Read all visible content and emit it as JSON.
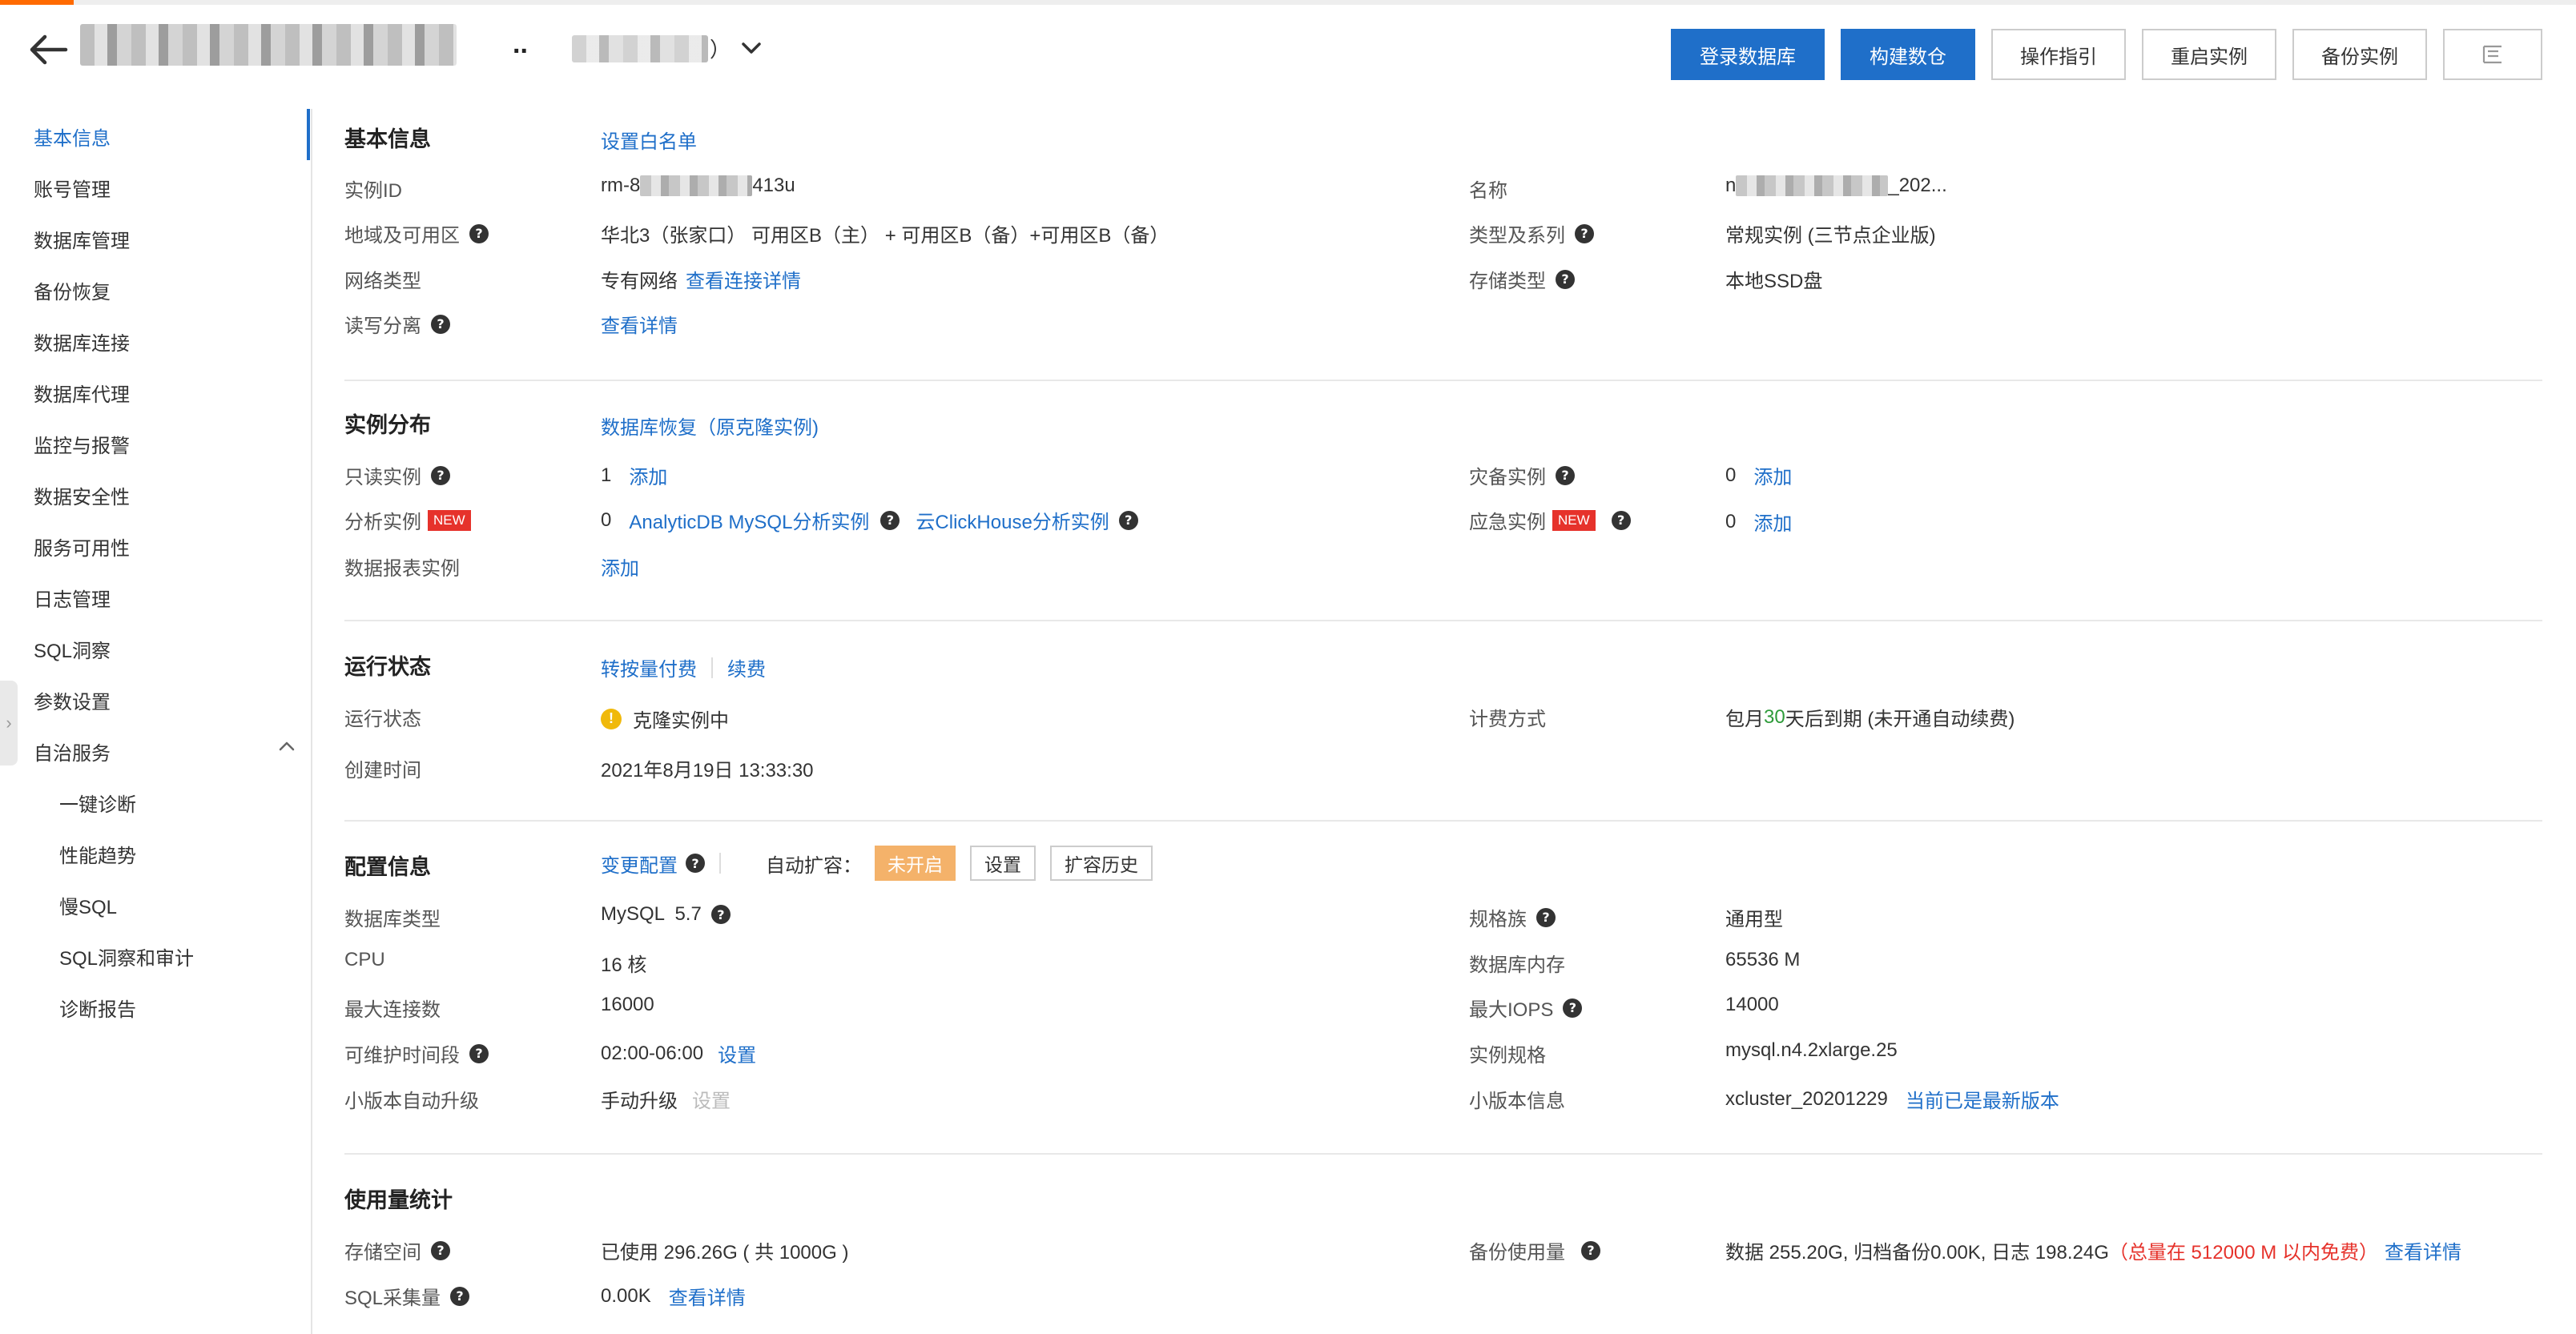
{
  "header": {
    "id_suffix": "）",
    "actions": [
      "登录数据库",
      "构建数仓",
      "操作指引",
      "重启实例",
      "备份实例"
    ],
    "icon_button": "list-icon"
  },
  "sidebar": {
    "items": [
      "基本信息",
      "账号管理",
      "数据库管理",
      "备份恢复",
      "数据库连接",
      "数据库代理",
      "监控与报警",
      "数据安全性",
      "服务可用性",
      "日志管理",
      "SQL洞察",
      "参数设置",
      "自治服务"
    ],
    "sub_items": [
      "一键诊断",
      "性能趋势",
      "慢SQL",
      "SQL洞察和审计",
      "诊断报告"
    ],
    "active": "基本信息"
  },
  "basic": {
    "title": "基本信息",
    "whitelist_link": "设置白名单",
    "instance_id_label": "实例ID",
    "instance_id_prefix": "rm-8",
    "instance_id_suffix": "413u",
    "name_label": "名称",
    "name_prefix": "n",
    "name_suffix": "_202...",
    "region_label": "地域及可用区",
    "region_value": "华北3（张家口） 可用区B（主） + 可用区B（备）+可用区B（备）",
    "type_label": "类型及系列",
    "type_value": "常规实例 (三节点企业版)",
    "network_label": "网络类型",
    "network_value": "专有网络",
    "network_link": "查看连接详情",
    "storage_type_label": "存储类型",
    "storage_type_value": "本地SSD盘",
    "rw_label": "读写分离",
    "rw_link": "查看详情"
  },
  "distribution": {
    "title": "实例分布",
    "restore_link": "数据库恢复（原克隆实例)",
    "readonly_label": "只读实例",
    "readonly_count": "1",
    "add_label": "添加",
    "disaster_label": "灾备实例",
    "disaster_count": "0",
    "analytic_label": "分析实例",
    "new_badge": "NEW",
    "analytic_count": "0",
    "analyticdb_link": "AnalyticDB MySQL分析实例",
    "clickhouse_link": "云ClickHouse分析实例",
    "emergency_label": "应急实例",
    "emergency_count": "0",
    "report_label": "数据报表实例"
  },
  "running": {
    "title": "运行状态",
    "pay_link": "转按量付费",
    "renew_link": "续费",
    "status_label": "运行状态",
    "status_value": "克隆实例中",
    "billing_label": "计费方式",
    "billing_prefix": "包月",
    "billing_days": "30",
    "billing_suffix": "天后到期 (未开通自动续费)",
    "created_label": "创建时间",
    "created_value": "2021年8月19日 13:33:30"
  },
  "config": {
    "title": "配置信息",
    "change_link": "变更配置",
    "autoscale_label": "自动扩容：",
    "autoscale_status": "未开启",
    "settings_button": "设置",
    "history_button": "扩容历史",
    "dbtype_label": "数据库类型",
    "dbtype_value": "MySQL  5.7",
    "family_label": "规格族",
    "family_value": "通用型",
    "cpu_label": "CPU",
    "cpu_value": "16 核",
    "mem_label": "数据库内存",
    "mem_value": "65536 M",
    "maxconn_label": "最大连接数",
    "maxconn_value": "16000",
    "iops_label": "最大IOPS",
    "iops_value": "14000",
    "maint_label": "可维护时间段",
    "maint_value": "02:00-06:00",
    "maint_link": "设置",
    "spec_label": "实例规格",
    "spec_value": "mysql.n4.2xlarge.25",
    "upgrade_label": "小版本自动升级",
    "upgrade_value": "手动升级",
    "upgrade_link": "设置",
    "version_label": "小版本信息",
    "version_value": "xcluster_20201229",
    "version_link": "当前已是最新版本"
  },
  "usage": {
    "title": "使用量统计",
    "storage_label": "存储空间",
    "storage_value": "已使用 296.26G ( 共 1000G )",
    "backup_label": "备份使用量",
    "backup_value": "数据 255.20G, 归档备份0.00K, 日志 198.24G",
    "backup_note": "（总量在 512000 M 以内免费）",
    "backup_link": "查看详情",
    "sql_label": "SQL采集量",
    "sql_value": "0.00K",
    "sql_link": "查看详情"
  }
}
